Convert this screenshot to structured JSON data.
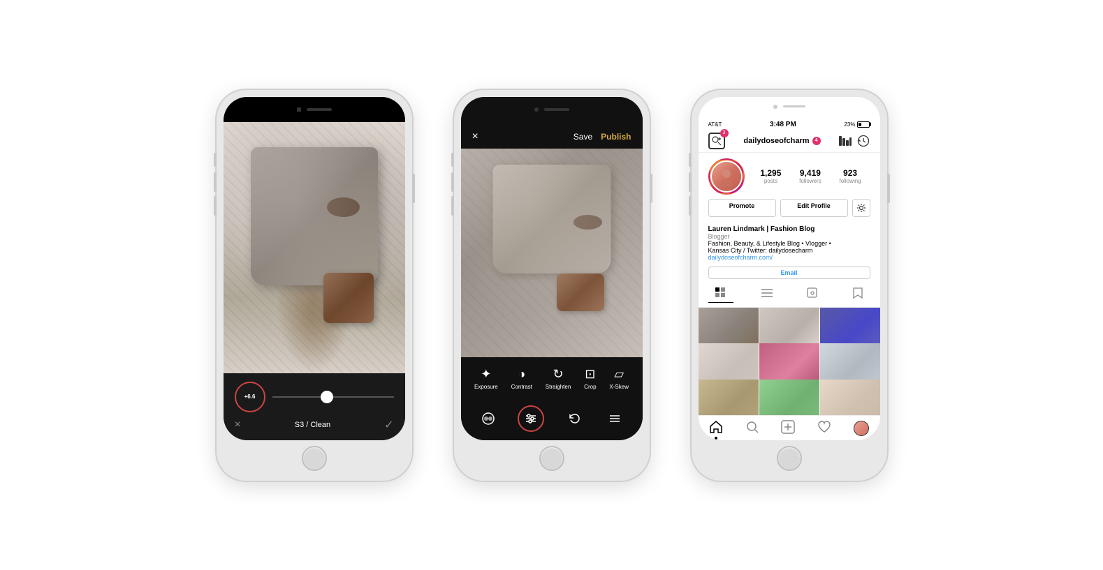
{
  "phones": {
    "phone1": {
      "filter_value": "+6.6",
      "filter_name": "S3 / Clean",
      "close_icon": "×",
      "check_icon": "✓"
    },
    "phone2": {
      "topbar": {
        "close": "×",
        "save": "Save",
        "publish": "Publish"
      },
      "tools": [
        {
          "icon": "☀",
          "label": "Exposure"
        },
        {
          "icon": "◑",
          "label": "Contrast"
        },
        {
          "icon": "↺",
          "label": "Straighten"
        },
        {
          "icon": "⊡",
          "label": "Crop"
        },
        {
          "icon": "▱",
          "label": "X-Skew"
        }
      ]
    },
    "phone3": {
      "status_bar": {
        "carrier": "AT&T",
        "time": "3:48 PM",
        "battery": "23%"
      },
      "profile": {
        "username": "dailydoseofcharm",
        "username_badge": "4",
        "add_badge": "3",
        "stats": {
          "posts": {
            "value": "1,295",
            "label": "posts"
          },
          "followers": {
            "value": "9,419",
            "label": "followers"
          },
          "following": {
            "value": "923",
            "label": "following"
          }
        },
        "buttons": {
          "promote": "Promote",
          "edit_profile": "Edit Profile"
        },
        "bio": {
          "name": "Lauren Lindmark | Fashion Blog",
          "category": "Blogger",
          "line1": "Fashion, Beauty, & Lifestyle Blog • Vlogger •",
          "line2": "Kansas City / Twitter: dailydosecharm",
          "link": "dailydoseofcharm.com/",
          "email": "Email"
        }
      }
    }
  }
}
